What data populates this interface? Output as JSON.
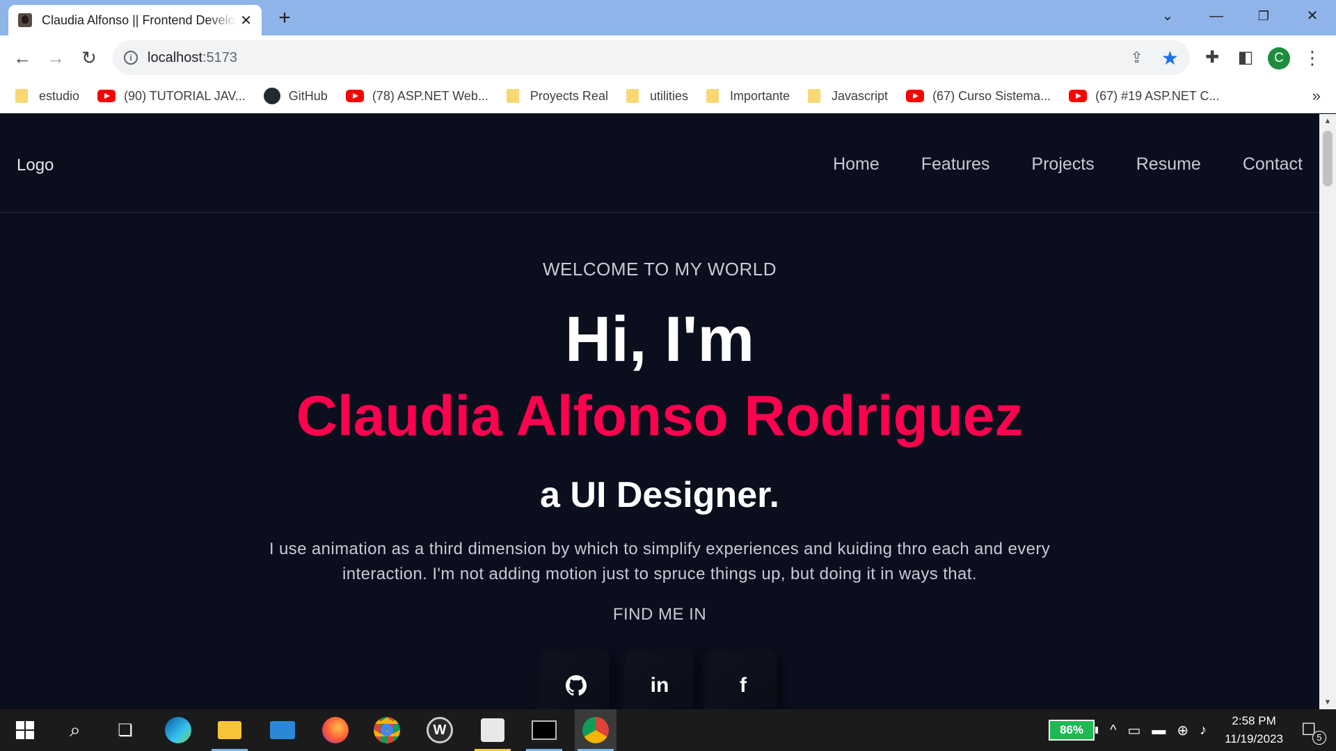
{
  "browser": {
    "tab_title": "Claudia Alfonso || Frontend Developer",
    "new_tab_glyph": "+",
    "url_host": "localhost",
    "url_port": ":5173",
    "profile_initial": "C",
    "bookmarks": [
      {
        "label": "estudio",
        "icon": "folder-icon"
      },
      {
        "label": "(90) TUTORIAL JAV...",
        "icon": "youtube-icon"
      },
      {
        "label": "GitHub",
        "icon": "github-icon"
      },
      {
        "label": "(78) ASP.NET Web...",
        "icon": "youtube-icon"
      },
      {
        "label": "Proyects Real",
        "icon": "folder-icon"
      },
      {
        "label": "utilities",
        "icon": "folder-icon"
      },
      {
        "label": "Importante",
        "icon": "folder-icon"
      },
      {
        "label": "Javascript",
        "icon": "folder-icon"
      },
      {
        "label": "(67) Curso Sistema...",
        "icon": "youtube-icon"
      },
      {
        "label": "(67) #19 ASP.NET C...",
        "icon": "youtube-icon"
      }
    ],
    "bookmarks_overflow": "»"
  },
  "site": {
    "logo": "Logo",
    "nav": [
      "Home",
      "Features",
      "Projects",
      "Resume",
      "Contact"
    ],
    "hero": {
      "welcome": "WELCOME TO MY WORLD",
      "greeting": "Hi, I'm",
      "name": "Claudia Alfonso Rodriguez",
      "role": "a UI Designer.",
      "description": "I use animation as a third dimension by which to simplify experiences and kuiding thro each and every interaction. I'm not adding motion just to spruce things up, but doing it in ways that.",
      "find_me": "FIND ME IN",
      "socials": [
        {
          "name": "github",
          "icon": "github-icon"
        },
        {
          "name": "linkedin",
          "icon": "linkedin-icon",
          "glyph": "in"
        },
        {
          "name": "facebook",
          "icon": "facebook-icon",
          "glyph": "f"
        }
      ]
    },
    "colors": {
      "background": "#0b0e1c",
      "accent": "#ff014f",
      "text": "#ffffff"
    }
  },
  "taskbar": {
    "battery": "86%",
    "time": "2:58 PM",
    "date": "11/19/2023",
    "notifications": "5"
  }
}
